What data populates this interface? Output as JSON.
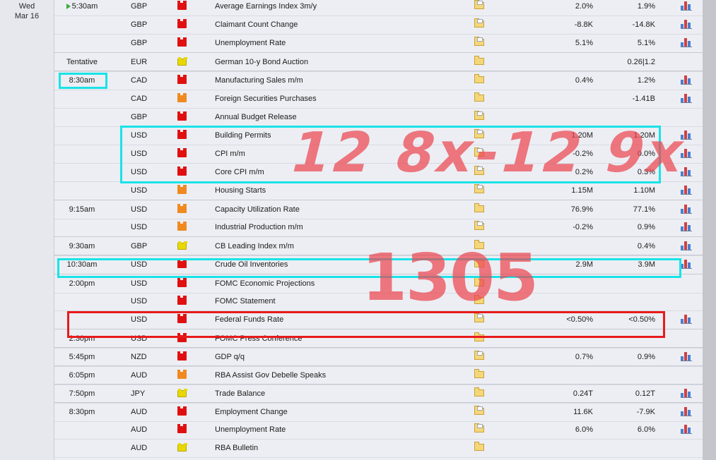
{
  "day": {
    "dow": "Wed",
    "date": "Mar 16"
  },
  "rows": [
    {
      "time": "5:30am",
      "now": true,
      "currency": "GBP",
      "impact": "high",
      "event": "Average Earnings Index 3m/y",
      "detail": "doc",
      "actual": "",
      "forecast": "2.0%",
      "previous": "1.9%",
      "graph": true
    },
    {
      "time": "",
      "currency": "GBP",
      "impact": "high",
      "event": "Claimant Count Change",
      "detail": "doc",
      "actual": "",
      "forecast": "-8.8K",
      "previous": "-14.8K",
      "graph": true
    },
    {
      "time": "",
      "currency": "GBP",
      "impact": "high",
      "event": "Unemployment Rate",
      "detail": "doc",
      "actual": "",
      "forecast": "5.1%",
      "previous": "5.1%",
      "graph": true
    },
    {
      "time": "Tentative",
      "currency": "EUR",
      "impact": "low",
      "event": "German 10-y Bond Auction",
      "detail": "folder",
      "actual": "",
      "forecast": "",
      "previous": "0.26|1.2",
      "graph": false,
      "sep": true
    },
    {
      "time": "8:30am",
      "currency": "CAD",
      "impact": "high",
      "event": "Manufacturing Sales m/m",
      "detail": "folder",
      "actual": "",
      "forecast": "0.4%",
      "previous": "1.2%",
      "graph": true,
      "sep": true
    },
    {
      "time": "",
      "currency": "CAD",
      "impact": "med",
      "event": "Foreign Securities Purchases",
      "detail": "folder",
      "actual": "",
      "forecast": "",
      "previous": "-1.41B",
      "graph": true
    },
    {
      "time": "",
      "currency": "GBP",
      "impact": "high",
      "event": "Annual Budget Release",
      "detail": "doc",
      "actual": "",
      "forecast": "",
      "previous": "",
      "graph": false
    },
    {
      "time": "",
      "currency": "USD",
      "impact": "high",
      "event": "Building Permits",
      "detail": "doc",
      "actual": "",
      "forecast": "1.20M",
      "previous": "1.20M",
      "graph": true
    },
    {
      "time": "",
      "currency": "USD",
      "impact": "high",
      "event": "CPI m/m",
      "detail": "doc",
      "actual": "",
      "forecast": "-0.2%",
      "previous": "0.0%",
      "graph": true
    },
    {
      "time": "",
      "currency": "USD",
      "impact": "high",
      "event": "Core CPI m/m",
      "detail": "doc",
      "actual": "",
      "forecast": "0.2%",
      "previous": "0.3%",
      "graph": true
    },
    {
      "time": "",
      "currency": "USD",
      "impact": "med",
      "event": "Housing Starts",
      "detail": "doc",
      "actual": "",
      "forecast": "1.15M",
      "previous": "1.10M",
      "graph": true
    },
    {
      "time": "9:15am",
      "currency": "USD",
      "impact": "med",
      "event": "Capacity Utilization Rate",
      "detail": "folder",
      "actual": "",
      "forecast": "76.9%",
      "previous": "77.1%",
      "graph": true,
      "sep": true
    },
    {
      "time": "",
      "currency": "USD",
      "impact": "med",
      "event": "Industrial Production m/m",
      "detail": "doc",
      "actual": "",
      "forecast": "-0.2%",
      "previous": "0.9%",
      "graph": true
    },
    {
      "time": "9:30am",
      "currency": "GBP",
      "impact": "low",
      "event": "CB Leading Index m/m",
      "detail": "folder",
      "actual": "",
      "forecast": "",
      "previous": "0.4%",
      "graph": true,
      "sep": true
    },
    {
      "time": "10:30am",
      "currency": "USD",
      "impact": "high",
      "event": "Crude Oil Inventories",
      "detail": "folder",
      "actual": "",
      "forecast": "2.9M",
      "previous": "3.9M",
      "graph": true,
      "sep": true
    },
    {
      "time": "2:00pm",
      "currency": "USD",
      "impact": "high",
      "event": "FOMC Economic Projections",
      "detail": "folder",
      "actual": "",
      "forecast": "",
      "previous": "",
      "graph": false,
      "sep": true
    },
    {
      "time": "",
      "currency": "USD",
      "impact": "high",
      "event": "FOMC Statement",
      "detail": "folder",
      "actual": "",
      "forecast": "",
      "previous": "",
      "graph": false
    },
    {
      "time": "",
      "currency": "USD",
      "impact": "high",
      "event": "Federal Funds Rate",
      "detail": "doc",
      "actual": "",
      "forecast": "<0.50%",
      "previous": "<0.50%",
      "graph": true
    },
    {
      "time": "2:30pm",
      "currency": "USD",
      "impact": "high",
      "event": "FOMC Press Conference",
      "detail": "folder",
      "actual": "",
      "forecast": "",
      "previous": "",
      "graph": false,
      "sep": true
    },
    {
      "time": "5:45pm",
      "currency": "NZD",
      "impact": "high",
      "event": "GDP q/q",
      "detail": "doc",
      "actual": "",
      "forecast": "0.7%",
      "previous": "0.9%",
      "graph": true,
      "sep": true
    },
    {
      "time": "6:05pm",
      "currency": "AUD",
      "impact": "med",
      "event": "RBA Assist Gov Debelle Speaks",
      "detail": "folder",
      "actual": "",
      "forecast": "",
      "previous": "",
      "graph": false,
      "sep": true
    },
    {
      "time": "7:50pm",
      "currency": "JPY",
      "impact": "low",
      "event": "Trade Balance",
      "detail": "folder",
      "actual": "",
      "forecast": "0.24T",
      "previous": "0.12T",
      "graph": true,
      "sep": true
    },
    {
      "time": "8:30pm",
      "currency": "AUD",
      "impact": "high",
      "event": "Employment Change",
      "detail": "doc",
      "actual": "",
      "forecast": "11.6K",
      "previous": "-7.9K",
      "graph": true,
      "sep": true
    },
    {
      "time": "",
      "currency": "AUD",
      "impact": "high",
      "event": "Unemployment Rate",
      "detail": "doc",
      "actual": "",
      "forecast": "6.0%",
      "previous": "6.0%",
      "graph": true
    },
    {
      "time": "",
      "currency": "AUD",
      "impact": "low",
      "event": "RBA Bulletin",
      "detail": "folder",
      "actual": "",
      "forecast": "",
      "previous": "",
      "graph": false
    }
  ],
  "annotations": {
    "handwriting_1": "12 8x-12 9x",
    "handwriting_2": "1305",
    "colors": {
      "cyan": "#19e3e8",
      "red": "#e81a1a",
      "ink": "#eb4650"
    }
  }
}
